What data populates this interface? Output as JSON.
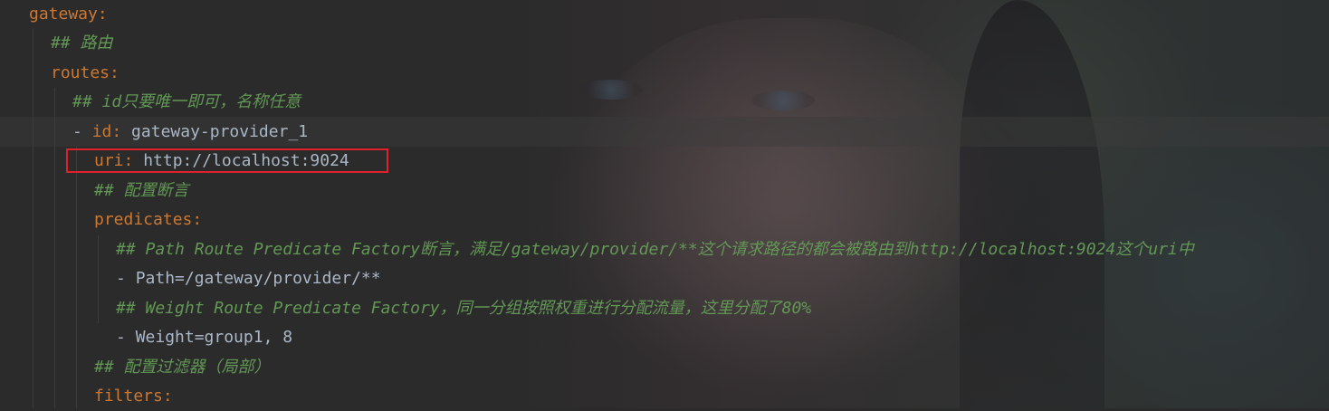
{
  "editor": {
    "lines": [
      {
        "indent": 0,
        "key": "gateway",
        "sep": ":",
        "value": "",
        "comment": ""
      },
      {
        "indent": 1,
        "key": "",
        "sep": "",
        "value": "",
        "comment": "## 路由"
      },
      {
        "indent": 1,
        "key": "routes",
        "sep": ":",
        "value": "",
        "comment": ""
      },
      {
        "indent": 2,
        "key": "",
        "sep": "",
        "value": "",
        "comment": "## id只要唯一即可，名称任意"
      },
      {
        "indent": 2,
        "dash": "- ",
        "key": "id",
        "sep": ":",
        "value": " gateway-provider_1",
        "comment": ""
      },
      {
        "indent": 3,
        "key": "uri",
        "sep": ":",
        "value": " http://localhost:9024",
        "comment": ""
      },
      {
        "indent": 3,
        "key": "",
        "sep": "",
        "value": "",
        "comment": "## 配置断言"
      },
      {
        "indent": 3,
        "key": "predicates",
        "sep": ":",
        "value": "",
        "comment": ""
      },
      {
        "indent": 4,
        "key": "",
        "sep": "",
        "value": "",
        "comment": "## Path Route Predicate Factory断言，满足/gateway/provider/**这个请求路径的都会被路由到http://localhost:9024这个uri中"
      },
      {
        "indent": 4,
        "dash": "- ",
        "key": "",
        "sep": "",
        "value": "Path=/gateway/provider/**",
        "comment": ""
      },
      {
        "indent": 4,
        "key": "",
        "sep": "",
        "value": "",
        "comment": "## Weight Route Predicate Factory，同一分组按照权重进行分配流量，这里分配了80%"
      },
      {
        "indent": 4,
        "dash": "- ",
        "key": "",
        "sep": "",
        "value": "Weight=group1, 8",
        "comment": ""
      },
      {
        "indent": 3,
        "key": "",
        "sep": "",
        "value": "",
        "comment": "## 配置过滤器（局部）"
      },
      {
        "indent": 3,
        "key": "filters",
        "sep": ":",
        "value": "",
        "comment": ""
      }
    ]
  },
  "colors": {
    "background": "#2b2b2b",
    "key": "#cc7832",
    "text": "#a9b7c6",
    "comment": "#629755",
    "highlight": "#e0202a"
  }
}
